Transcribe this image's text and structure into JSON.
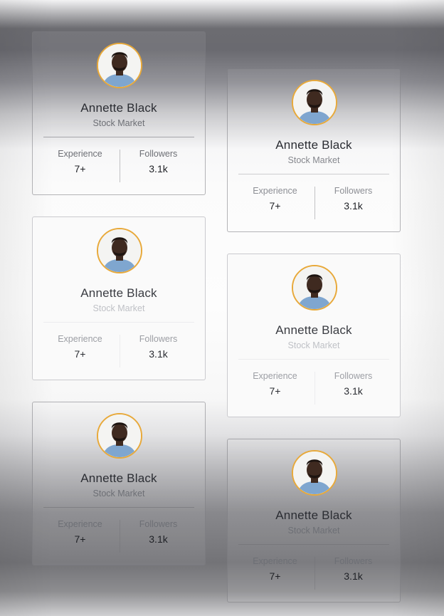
{
  "cards": [
    {
      "name": "Annette Black",
      "subtitle": "Stock Market",
      "stats": {
        "experience_label": "Experience",
        "experience_value": "7+",
        "followers_label": "Followers",
        "followers_value": "3.1k"
      }
    },
    {
      "name": "Annette Black",
      "subtitle": "Stock Market",
      "stats": {
        "experience_label": "Experience",
        "experience_value": "7+",
        "followers_label": "Followers",
        "followers_value": "3.1k"
      }
    },
    {
      "name": "Annette Black",
      "subtitle": "Stock Market",
      "stats": {
        "experience_label": "Experience",
        "experience_value": "7+",
        "followers_label": "Followers",
        "followers_value": "3.1k"
      }
    },
    {
      "name": "Annette Black",
      "subtitle": "Stock Market",
      "stats": {
        "experience_label": "Experience",
        "experience_value": "7+",
        "followers_label": "Followers",
        "followers_value": "3.1k"
      }
    },
    {
      "name": "Annette Black",
      "subtitle": "Stock Market",
      "stats": {
        "experience_label": "Experience",
        "experience_value": "7+",
        "followers_label": "Followers",
        "followers_value": "3.1k"
      }
    },
    {
      "name": "Annette Black",
      "subtitle": "Stock Market",
      "stats": {
        "experience_label": "Experience",
        "experience_value": "7+",
        "followers_label": "Followers",
        "followers_value": "3.1k"
      }
    }
  ],
  "colors": {
    "avatar_ring": "#e8a93a",
    "shirt": "#7fa6cf",
    "skin": "#3f2a20",
    "text_primary": "#2b2d33",
    "text_secondary": "#6d6f75"
  },
  "icons": {
    "avatar": "person-photo"
  }
}
